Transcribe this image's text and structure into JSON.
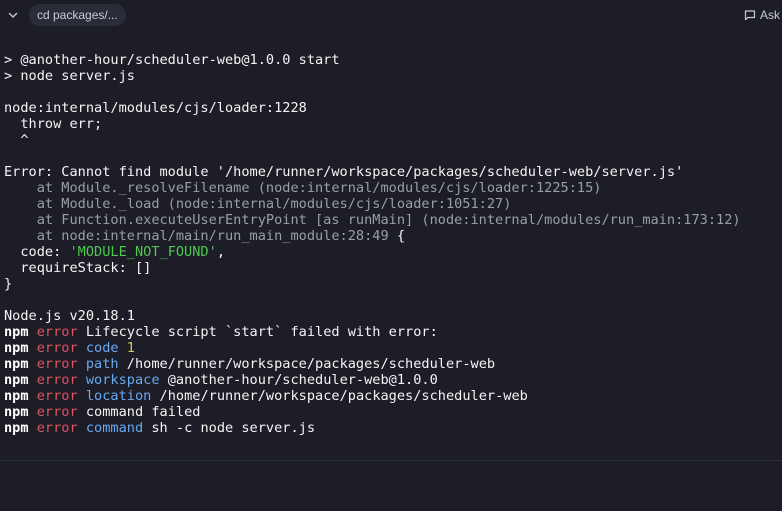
{
  "header": {
    "tab_label": "cd packages/...",
    "ask_label": "Ask"
  },
  "colors": {
    "background": "#1c1d26",
    "text": "#f5f5f5",
    "dim": "#9b9ea8",
    "string": "#4ec94e",
    "error": "#e0525e",
    "keyword": "#6aa8f0",
    "number": "#e0c45c"
  },
  "terminal": {
    "prompt1": "> @another-hour/scheduler-web@1.0.0 start",
    "prompt2": "> node server.js",
    "loader": "node:internal/modules/cjs/loader:1228",
    "throw_line": "  throw err;",
    "caret": "  ^",
    "error_msg": "Error: Cannot find module '/home/runner/workspace/packages/scheduler-web/server.js'",
    "stack": [
      "    at Module._resolveFilename (node:internal/modules/cjs/loader:1225:15)",
      "    at Module._load (node:internal/modules/cjs/loader:1051:27)",
      "    at Function.executeUserEntryPoint [as runMain] (node:internal/modules/run_main:173:12)",
      "    at node:internal/main/run_main_module:28:49"
    ],
    "stack_brace": " {",
    "code_key": "  code: ",
    "code_value": "'MODULE_NOT_FOUND'",
    "code_comma": ",",
    "require_stack": "  requireStack: []",
    "close_brace": "}",
    "node_version": "Node.js v20.18.1",
    "npm_lines": [
      {
        "prefix": "npm",
        "level": "error",
        "key": "",
        "value": " Lifecycle script `start` failed with error:"
      },
      {
        "prefix": "npm",
        "level": "error",
        "key": " code",
        "value": " 1"
      },
      {
        "prefix": "npm",
        "level": "error",
        "key": " path",
        "value": " /home/runner/workspace/packages/scheduler-web"
      },
      {
        "prefix": "npm",
        "level": "error",
        "key": " workspace",
        "value": " @another-hour/scheduler-web@1.0.0"
      },
      {
        "prefix": "npm",
        "level": "error",
        "key": " location",
        "value": " /home/runner/workspace/packages/scheduler-web"
      },
      {
        "prefix": "npm",
        "level": "error",
        "key": "",
        "value": " command failed"
      },
      {
        "prefix": "npm",
        "level": "error",
        "key": " command",
        "value": " sh -c node server.js"
      }
    ]
  }
}
